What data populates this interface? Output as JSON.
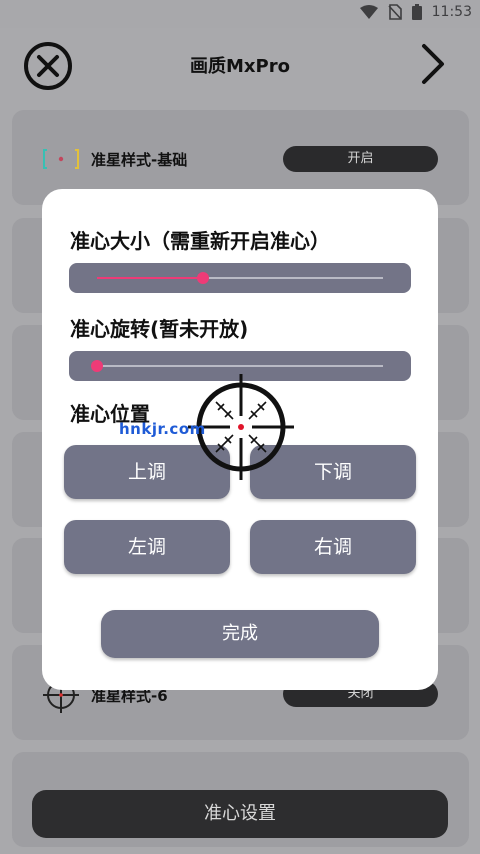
{
  "status_bar": {
    "time": "11:53",
    "icons": [
      "wifi-icon",
      "no-sim-icon",
      "battery-icon"
    ]
  },
  "header": {
    "title": "画质MxPro",
    "close_icon": "close-circle-icon",
    "next_icon": "chevron-right-icon"
  },
  "background_list": {
    "rows": [
      {
        "label": "准星样式-基础",
        "toggle": "开启"
      },
      {
        "label": "准星样式-6",
        "toggle": "关闭"
      }
    ],
    "bottom_button": "准心设置"
  },
  "dialog": {
    "size_label": "准心大小（需重新开启准心）",
    "size_value": 0.37,
    "rotation_label": "准心旋转(暂未开放)",
    "rotation_value": 0.0,
    "position_label": "准心位置",
    "buttons": {
      "up": "上调",
      "down": "下调",
      "left": "左调",
      "right": "右调"
    },
    "done": "完成"
  },
  "watermark": "hnkjr.com",
  "colors": {
    "accent": "#ee3b77",
    "button": "#727488",
    "toggle_bg": "#2a2a2c"
  }
}
